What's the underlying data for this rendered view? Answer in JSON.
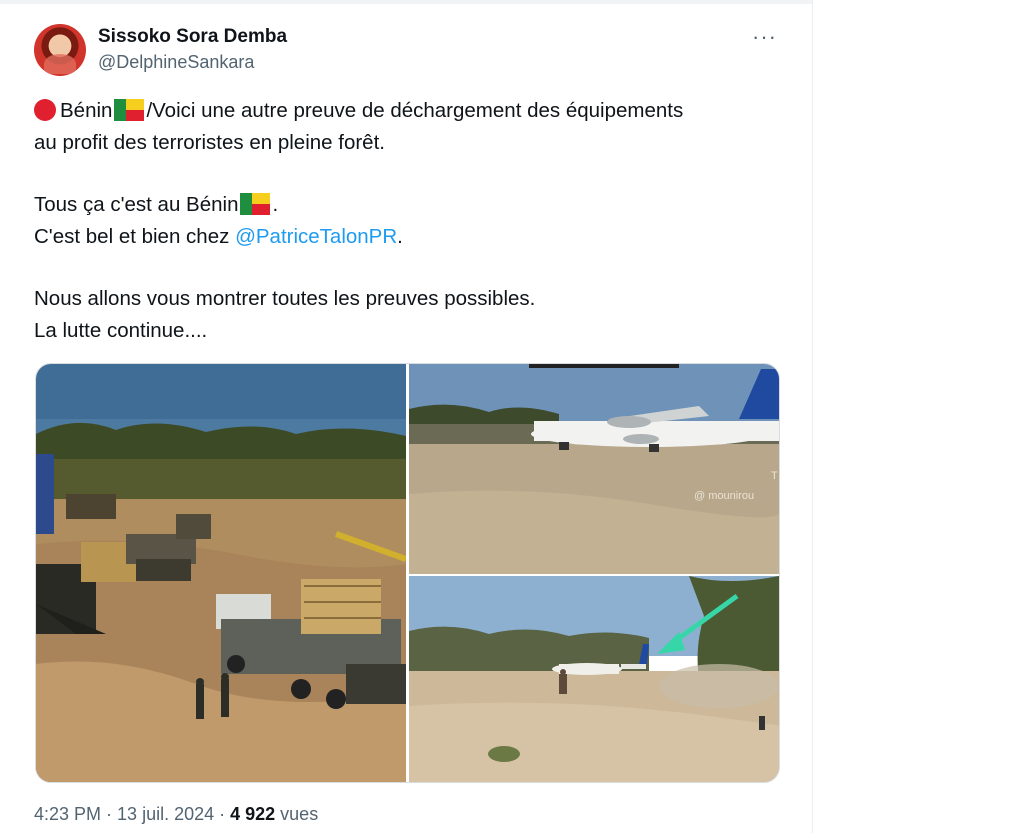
{
  "tweet": {
    "author_name": "Sissoko Sora Demba",
    "author_handle": "@DelphineSankara",
    "more_label": "···",
    "line1_text": "Bénin",
    "line1_rest": "/Voici une autre preuve de déchargement des équipements",
    "line2": "au profit des terroristes en pleine forêt.",
    "line3_text": "Tous ça c'est au Bénin",
    "line3_end": ".",
    "line4_text": "C'est bel et bien chez ",
    "line4_mention": "@PatriceTalonPR",
    "line4_end": ".",
    "line5": "Nous allons vous montrer toutes les preuves possibles.",
    "line6": "La lutte continue....",
    "time": "4:23 PM",
    "separator": " · ",
    "date": "13 juil. 2024",
    "views_count": "4 922",
    "views_label": " vues"
  },
  "media": {
    "watermark": "@ mounirou",
    "watermark_edge": "T"
  },
  "colors": {
    "accent": "#1d9bf0",
    "flag_green": "#1f8e3e",
    "flag_yellow": "#f6cf1e",
    "flag_red": "#e0202f",
    "arrow": "#37d6a9"
  },
  "icons": [
    "red-circle-icon",
    "benin-flag-icon",
    "more-options-icon"
  ]
}
